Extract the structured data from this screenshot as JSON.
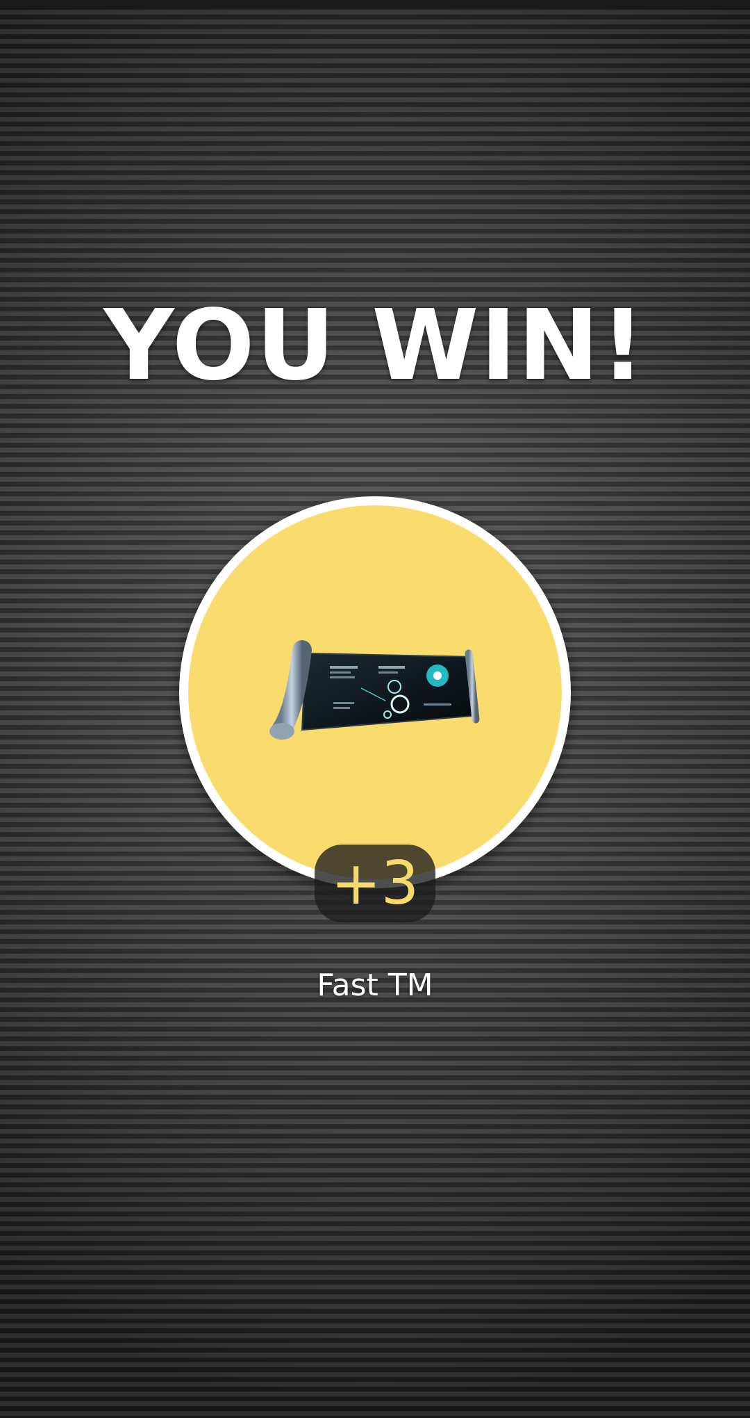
{
  "result": {
    "title": "YOU WIN!"
  },
  "reward": {
    "icon": "tm-scroll-icon",
    "quantity": "+3",
    "name": "Fast TM"
  },
  "colors": {
    "circle_fill": "#f9dc6d",
    "circle_border": "#ffffff",
    "quantity_text": "#f6da6c",
    "title_text": "#ffffff"
  }
}
